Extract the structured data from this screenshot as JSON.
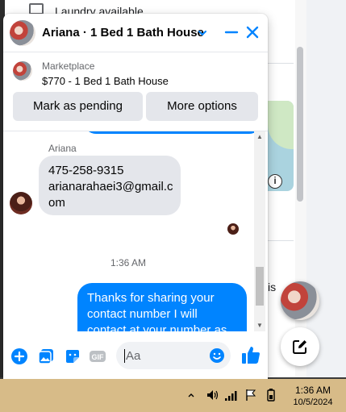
{
  "background": {
    "feed_item_text": "Laundry available",
    "partial_text": "is"
  },
  "chat": {
    "title": "Ariana · 1 Bed 1 Bath House",
    "listing": {
      "label": "Marketplace",
      "item": "$770 - 1 Bed 1 Bath House"
    },
    "buttons": {
      "mark_pending": "Mark as pending",
      "more_options": "More options"
    },
    "messages": {
      "sender_name": "Ariana",
      "incoming_lines": [
        "475-258-9315",
        "arianarahaei3@gmail.c",
        "om"
      ],
      "timestamp": "1:36 AM",
      "outgoing_lines": [
        "Thanks for sharing your",
        "contact number I will",
        "contact at your number as"
      ]
    },
    "composer": {
      "placeholder": "Aa",
      "icons": [
        "add-circle-icon",
        "photo-icon",
        "sticker-icon",
        "gif-icon",
        "emoji-icon",
        "thumbs-up-icon"
      ]
    }
  },
  "colors": {
    "accent": "#0084ff",
    "taskbar": "#d7bb88"
  },
  "taskbar": {
    "time": "1:36 AM",
    "date": "10/5/2024"
  }
}
